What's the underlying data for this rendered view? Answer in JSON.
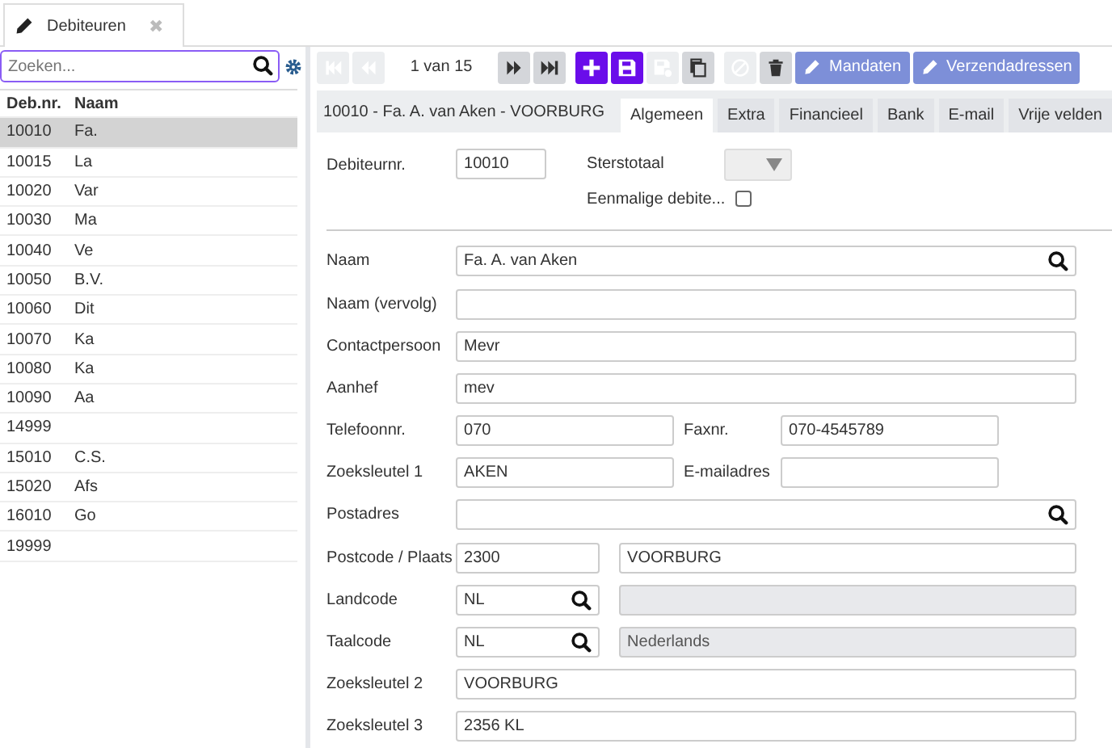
{
  "doc_tab": {
    "label": "Debiteuren",
    "close": "✖"
  },
  "search": {
    "placeholder": "Zoeken..."
  },
  "list": {
    "columns": [
      "Deb.nr.",
      "Naam"
    ],
    "rows": [
      {
        "nr": "10010",
        "name": "Fa.",
        "selected": true
      },
      {
        "nr": "10015",
        "name": "La",
        "selected": false
      },
      {
        "nr": "10020",
        "name": "Var",
        "selected": false
      },
      {
        "nr": "10030",
        "name": "Ma",
        "selected": false
      },
      {
        "nr": "10040",
        "name": "Ve",
        "selected": false
      },
      {
        "nr": "10050",
        "name": "B.V.",
        "selected": false
      },
      {
        "nr": "10060",
        "name": "Dit",
        "selected": false
      },
      {
        "nr": "10070",
        "name": "Ka",
        "selected": false
      },
      {
        "nr": "10080",
        "name": "Ka",
        "selected": false
      },
      {
        "nr": "10090",
        "name": "Aa",
        "selected": false
      },
      {
        "nr": "14999",
        "selected": false
      },
      {
        "nr": "15010",
        "name": "C.S.",
        "selected": false
      },
      {
        "nr": "15020",
        "name": "Afs",
        "selected": false
      },
      {
        "nr": "16010",
        "name": "Go",
        "selected": false
      },
      {
        "nr": "19999",
        "selected": false
      }
    ]
  },
  "toolbar": {
    "counter": "1 van 15",
    "tools": [
      {
        "kind": "first",
        "disabled": true
      },
      {
        "kind": "prev",
        "disabled": true
      },
      {
        "kind": "counter"
      },
      {
        "kind": "next",
        "disabled": false
      },
      {
        "kind": "last",
        "disabled": false
      },
      {
        "kind": "add",
        "disabled": false
      },
      {
        "kind": "save",
        "disabled": false
      },
      {
        "kind": "save_as",
        "disabled": true
      },
      {
        "kind": "copy",
        "disabled": false
      },
      {
        "kind": "cancel",
        "disabled": true
      },
      {
        "kind": "delete",
        "disabled": false
      }
    ],
    "actions": [
      {
        "label": "Mandaten"
      },
      {
        "label": "Verzendadressen"
      }
    ]
  },
  "record": {
    "title": "10010 - Fa. A. van Aken - VOORBURG",
    "tabs": [
      {
        "label": "Algemeen",
        "selected": true
      },
      {
        "label": "Extra",
        "selected": false
      },
      {
        "label": "Financieel",
        "selected": false
      },
      {
        "label": "Bank",
        "selected": false
      },
      {
        "label": "E-mail",
        "selected": false
      },
      {
        "label": "Vrije velden",
        "selected": false
      }
    ]
  },
  "header_fields": {
    "number_label": "Debiteurnr.",
    "number": "10010",
    "stars_label": "Sterstotaal",
    "once_label": "Eenmalige debite...",
    "once_checked": false
  },
  "form": [
    {
      "label": "Naam",
      "fields": [
        {
          "value": "Fa. A. van Aken",
          "search": true,
          "readonly": false
        }
      ]
    },
    {
      "label": "Naam (vervolg)",
      "fields": [
        {
          "search": false,
          "readonly": false
        }
      ]
    },
    {
      "label": "Contactpersoon",
      "fields": [
        {
          "value": "Mevr",
          "search": false,
          "readonly": false
        }
      ]
    },
    {
      "label": "Aanhef",
      "fields": [
        {
          "value": "mev",
          "search": false,
          "readonly": false
        }
      ]
    },
    {
      "label": "Telefoonnr.",
      "fields": [
        {
          "value": "070",
          "search": false,
          "readonly": false
        }
      ],
      "label2": "Faxnr.",
      "fields2": [
        {
          "value": "070-4545789",
          "search": false,
          "readonly": false
        }
      ]
    },
    {
      "label": "Zoeksleutel 1",
      "fields": [
        {
          "value": "AKEN",
          "search": false,
          "readonly": false
        }
      ],
      "label2": "E-mailadres",
      "fields2": [
        {
          "search": false,
          "readonly": false
        }
      ]
    },
    {
      "label": "Postadres",
      "fields": [
        {
          "search": true,
          "readonly": false
        }
      ]
    },
    {
      "label": "Postcode / Plaats",
      "fields": [
        {
          "value": "2300",
          "search": false,
          "readonly": false
        },
        {
          "value": "VOORBURG",
          "search": false,
          "readonly": false
        }
      ]
    },
    {
      "label": "Landcode",
      "fields": [
        {
          "value": "NL",
          "search": true,
          "readonly": false
        },
        {
          "search": false,
          "readonly": true
        }
      ]
    },
    {
      "label": "Taalcode",
      "fields": [
        {
          "value": "NL",
          "search": true,
          "readonly": false
        },
        {
          "value": "Nederlands",
          "search": false,
          "readonly": true
        }
      ]
    },
    {
      "label": "Zoeksleutel 2",
      "fields": [
        {
          "value": "VOORBURG",
          "search": false,
          "readonly": false
        }
      ]
    },
    {
      "label": "Zoeksleutel 3",
      "fields": [
        {
          "value": "2356 KL",
          "search": false,
          "readonly": false
        }
      ]
    }
  ]
}
